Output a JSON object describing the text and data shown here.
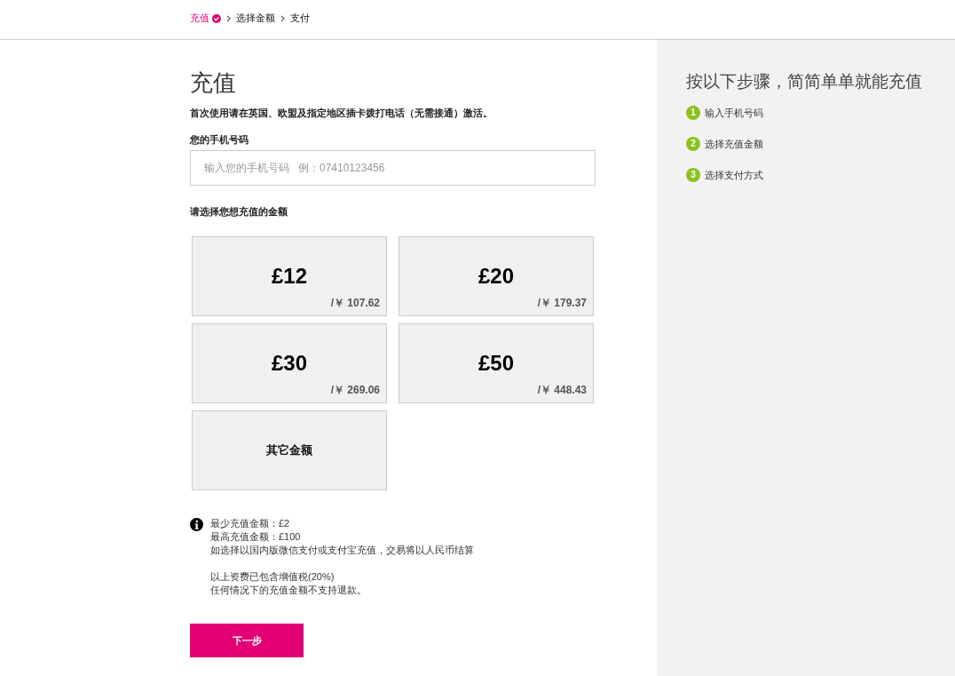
{
  "breadcrumb": [
    {
      "label": "充值",
      "done": true
    },
    {
      "label": "选择金额",
      "done": false
    },
    {
      "label": "支付",
      "done": false
    }
  ],
  "topup": {
    "title": "充值",
    "notice": "首次使用请在英国、欧盟及指定地区插卡拨打电话（无需接通）激活。",
    "phone_label": "您的手机号码",
    "phone_field": {
      "placeholder": "输入您的手机号码   例：07410123456"
    },
    "amount_label": "请选择您想充值的金额",
    "amounts": [
      {
        "kind": "amount",
        "price": "£12",
        "converted": "/￥ 107.62",
        "selected": false
      },
      {
        "kind": "amount",
        "price": "£20",
        "converted": "/￥ 179.37",
        "selected": false
      },
      {
        "kind": "amount",
        "price": "£30",
        "converted": "/￥ 269.06",
        "selected": false
      },
      {
        "kind": "amount",
        "price": "£50",
        "converted": "/￥ 448.43",
        "selected": false
      },
      {
        "kind": "other",
        "label": "其它金额",
        "selected": false
      }
    ],
    "notes": [
      [
        "最少充值金额：£2",
        "最高充值金额：£100",
        "如选择以国内版微信支付或支付宝充值，交易将以人民币结算"
      ],
      [
        "以上资费已包含增值税(20%)",
        "任何情况下的充值金额不支持退款。"
      ]
    ],
    "next_button": "下一步"
  },
  "steps_panel": {
    "title": "按以下步骤，简简单单就能充值",
    "steps": [
      {
        "number": "1",
        "label": "输入手机号码"
      },
      {
        "number": "2",
        "label": "选择充值金额"
      },
      {
        "number": "3",
        "label": "选择支付方式"
      }
    ]
  }
}
